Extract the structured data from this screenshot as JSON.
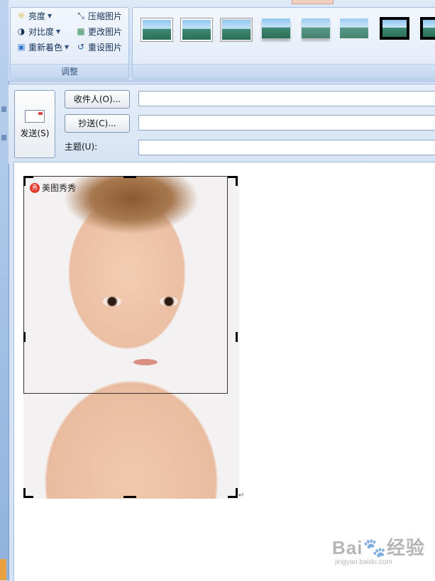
{
  "ribbon": {
    "adjust_group": {
      "label": "调整",
      "brightness": "亮度",
      "contrast": "对比度",
      "recolor": "重新着色",
      "compress": "压缩图片",
      "change_picture": "更改图片",
      "reset_picture": "重设图片"
    },
    "picture_styles": {
      "thumbnails": [
        "white-frame",
        "white-frame",
        "grey-frame",
        "soft-edge",
        "reflection",
        "fade",
        "black-frame",
        "black-frame"
      ]
    }
  },
  "mail": {
    "send_label": "发送(S)",
    "to_button": "收件人(O)...",
    "cc_button": "抄送(C)...",
    "subject_label": "主题(U):",
    "to_value": "",
    "cc_value": "",
    "subject_value": ""
  },
  "body": {
    "photo_watermark": "美图秀秀",
    "paragraph_mark": "↵"
  },
  "site_watermark": {
    "brand_left": "Bai",
    "brand_mid": "du",
    "brand_right": "经验",
    "url": "jingyan.baidu.com"
  },
  "colors": {
    "ribbon_bg": "#d5e3f4",
    "accent_tab": "#f3cfbf"
  }
}
